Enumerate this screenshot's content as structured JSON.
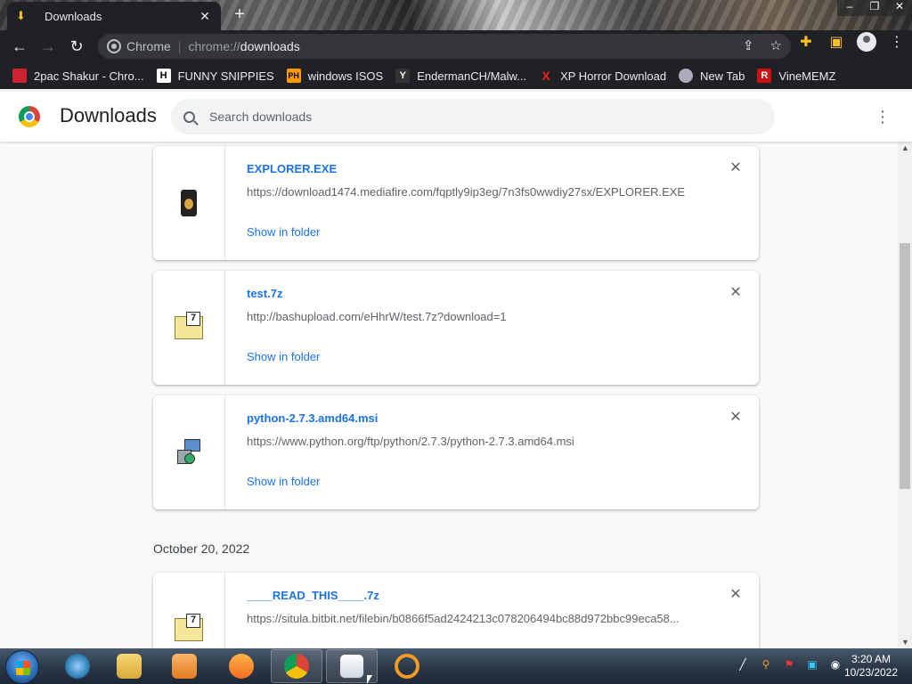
{
  "browser": {
    "tab": {
      "title": "Downloads",
      "favicon": "download-icon"
    },
    "omnibox": {
      "label": "Chrome",
      "scheme": "chrome://",
      "host": "downloads"
    },
    "bookmarks": [
      {
        "label": "2pac Shakur - Chro...",
        "icon": "bookmark-favicon"
      },
      {
        "label": "FUNNY SNIPPIES",
        "icon": "H"
      },
      {
        "label": "windows ISOS",
        "icon": "PH"
      },
      {
        "label": "EndermanCH/Malw...",
        "icon": "Y"
      },
      {
        "label": "XP Horror Download",
        "icon": "X"
      },
      {
        "label": "New Tab",
        "icon": "globe-icon"
      },
      {
        "label": "VineMEMZ",
        "icon": "R"
      }
    ]
  },
  "downloads": {
    "title": "Downloads",
    "search_placeholder": "Search downloads",
    "items": [
      {
        "name": "EXPLORER.EXE",
        "url": "https://download1474.mediafire.com/fqptly9ip3eg/7n3fs0wwdiy27sx/EXPLORER.EXE",
        "action": "Show in folder",
        "icon": "exe-file-icon"
      },
      {
        "name": "test.7z",
        "url": "http://bashupload.com/eHhrW/test.7z?download=1",
        "action": "Show in folder",
        "icon": "7z-archive-icon"
      },
      {
        "name": "python-2.7.3.amd64.msi",
        "url": "https://www.python.org/ftp/python/2.7.3/python-2.7.3.amd64.msi",
        "action": "Show in folder",
        "icon": "msi-installer-icon"
      }
    ],
    "date_group": "October 20, 2022",
    "items2": [
      {
        "name": "____READ_THIS____.7z",
        "url": "https://situla.bitbit.net/filebin/b0866f5ad2424213c078206494bc88d972bbc99eca58...",
        "icon": "7z-archive-icon"
      }
    ]
  },
  "taskbar": {
    "clock_time": "3:20 AM",
    "clock_date": "10/23/2022"
  }
}
